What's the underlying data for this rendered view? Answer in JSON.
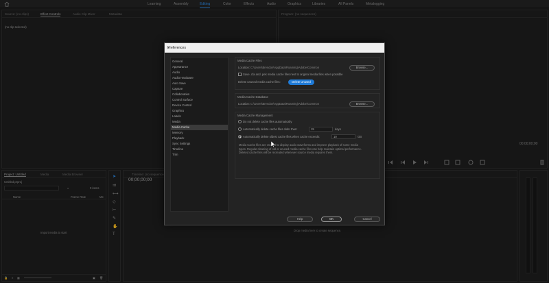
{
  "workspace_bar": {
    "items": [
      "Learning",
      "Assembly",
      "Editing",
      "Color",
      "Effects",
      "Audio",
      "Graphics",
      "Libraries",
      "All Panels",
      "Metalogging"
    ],
    "active": "Editing"
  },
  "source_panel": {
    "tabs": [
      "Source: (no clips)",
      "Effect Controls",
      "Audio Clip Mixer",
      "Metadata"
    ],
    "content": "(no clip selected)"
  },
  "program_panel": {
    "tab": "Program: (no sequences)",
    "timecode": "00;00;00;00"
  },
  "project_panel": {
    "tabs": [
      "Project: Untitled",
      "Media",
      "Media Browser"
    ],
    "project_name": "Untitled.prproj",
    "items_count": "0 items",
    "col_name": "Name",
    "col_frame_rate": "Frame Rate",
    "col_media": "Me",
    "empty_text": "Import media to start"
  },
  "timeline_panel": {
    "tab": "Timeline: (no sequences)",
    "timecode": "00;00;00;00",
    "empty_text": "Drop media here to create sequence."
  },
  "dialog": {
    "title": "Preferences",
    "categories": [
      "General",
      "Appearance",
      "Audio",
      "Audio Hardware",
      "Auto Save",
      "Capture",
      "Collaboration",
      "Control Surface",
      "Device Control",
      "Graphics",
      "Labels",
      "Media",
      "Media Cache",
      "Memory",
      "Playback",
      "Sync Settings",
      "Timeline",
      "Trim"
    ],
    "selected_category": "Media Cache",
    "cache_files": {
      "title": "Media Cache Files",
      "location_label": "Location:",
      "location_path": "C:\\Users\\Brendon\\AppData\\Roaming\\Adobe\\Common",
      "browse": "Browse...",
      "save_checkbox": "Save .cfa and .pek media cache files next to original media files when possible",
      "delete_label": "Delete unused media cache files:",
      "delete_button": "Delete Unused"
    },
    "cache_db": {
      "title": "Media Cache Database",
      "location_label": "Location:",
      "location_path": "C:\\Users\\Brendon\\AppData\\Roaming\\Adobe\\Common",
      "browse": "Browse..."
    },
    "management": {
      "title": "Media Cache Management",
      "opt1": "Do not delete cache files automatically",
      "opt2": "Automatically delete cache files older than:",
      "opt2_value": "15",
      "opt2_unit": "days",
      "opt3": "Automatically delete oldest cache files when cache exceeds:",
      "opt3_value": "10",
      "opt3_unit": "GB",
      "description": "Media Cache files are created to display audio waveforms and improve playback of some media types. Regular cleaning of old or unused media cache files can help maintain optimal performance. Deleted cache files will be recreated whenever source media requires them."
    },
    "help": "Help",
    "ok": "OK",
    "cancel": "Cancel"
  }
}
